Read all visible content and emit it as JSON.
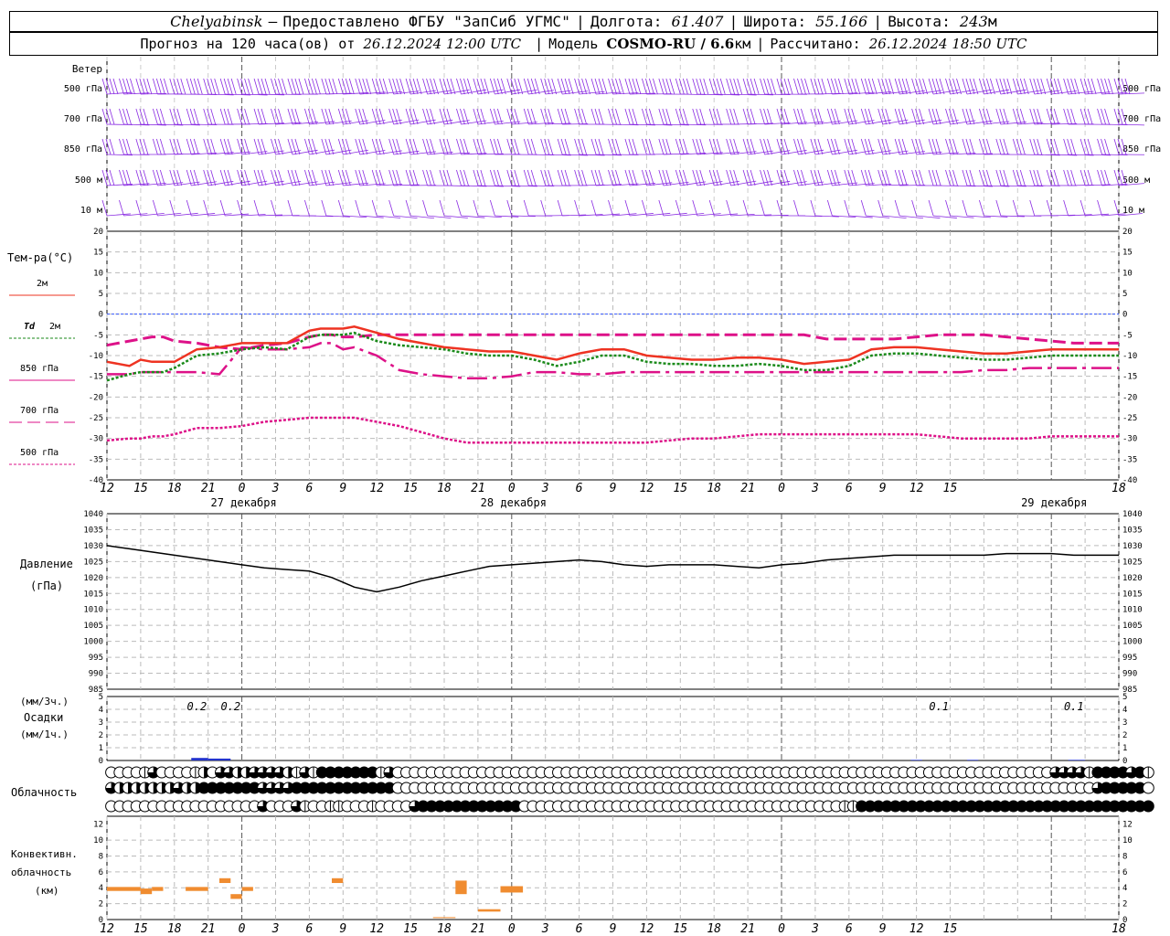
{
  "header": {
    "station": "Chelyabinsk",
    "dash": "–",
    "provider": "Предоставлено ФГБУ \"ЗапСиб УГМС\"",
    "lon_label": "Долгота:",
    "lon": "61.407",
    "lat_label": "Широта:",
    "lat": "55.166",
    "alt_label": "Высота:",
    "alt": "243",
    "alt_unit": "м",
    "forecast_label": "Прогноз на 120 часа(ов) от",
    "forecast_time": "26.12.2024 12:00 UTC",
    "model_label": "Модель",
    "model": "COSMO-RU / 6.6",
    "model_unit": "км",
    "calc_label": "Рассчитано:",
    "calc_time": "26.12.2024 18:50 UTC"
  },
  "x_ticks": [
    "12",
    "15",
    "18",
    "21",
    "0",
    "3",
    "6",
    "9",
    "12",
    "15",
    "18",
    "21",
    "0",
    "3",
    "6",
    "9",
    "12",
    "15",
    "18",
    "21",
    "0",
    "3",
    "6",
    "9",
    "12",
    "15",
    "18"
  ],
  "day_labels": [
    "27 декабря",
    "28 декабря",
    "29 декабря"
  ],
  "wind": {
    "title": "Ветер",
    "levels": [
      "500 гПа",
      "700 гПа",
      "850 гПа",
      "500 м",
      "10  м"
    ],
    "color": "#8a2be2"
  },
  "temperature": {
    "title": "Тем-ра(°С)",
    "ticks": [
      "20",
      "15",
      "10",
      "5",
      "0",
      "-5",
      "-10",
      "-15",
      "-20",
      "-25",
      "-30",
      "-35",
      "-40"
    ],
    "legend": [
      {
        "label": "2м",
        "color": "#ee3322"
      },
      {
        "label_a": "Td",
        "label": "2м",
        "color": "#1a8a1a"
      },
      {
        "label": "850 гПа",
        "color": "#dd1188"
      },
      {
        "label": "700 гПа",
        "color": "#dd1188"
      },
      {
        "label": "500 гПа",
        "color": "#dd1188"
      }
    ]
  },
  "pressure": {
    "title": "Давление",
    "unit": "(гПа)",
    "ticks": [
      "1040",
      "1035",
      "1030",
      "1025",
      "1020",
      "1015",
      "1010",
      "1005",
      "1000",
      "995",
      "990",
      "985"
    ]
  },
  "precipitation": {
    "unit_a": "(мм/3ч.)",
    "title": "Осадки",
    "unit_b": "(мм/1ч.)",
    "ticks": [
      "5",
      "4",
      "3",
      "2",
      "1",
      "0"
    ],
    "labels": [
      {
        "hour": 8,
        "text": "0.2"
      },
      {
        "hour": 11,
        "text": "0.2"
      },
      {
        "hour": 74,
        "text": "0.1"
      },
      {
        "hour": 86,
        "text": "0.1"
      }
    ],
    "color": "#2233cc"
  },
  "clouds": {
    "title": "Облачность",
    "rows": [
      "0000130000120332233332131444444413000000000000000000000000000000000000000000000000000000000000000000000000000000333314444341",
      "3222222232244444443333444444444444000000000000000000000000000000000000000000000000000000000000000000000000000000000003444440",
      "0000000000000000003000310011000100003444444444444000000000000000000000000000000000000001144444444444444444444444444444444444"
    ]
  },
  "convective": {
    "title_a": "Конвективн.",
    "title_b": "облачность",
    "unit": "(км)",
    "ticks": [
      "12",
      "10",
      "8",
      "6",
      "4",
      "2",
      "0"
    ],
    "color": "#f08c30",
    "bars": [
      {
        "h0": 0,
        "h1": 3,
        "lo": 3.6,
        "hi": 4.1
      },
      {
        "h0": 3,
        "h1": 4,
        "lo": 3.2,
        "hi": 3.9
      },
      {
        "h0": 4,
        "h1": 5,
        "lo": 3.6,
        "hi": 4.1
      },
      {
        "h0": 7,
        "h1": 9,
        "lo": 3.6,
        "hi": 4.1
      },
      {
        "h0": 10,
        "h1": 11,
        "lo": 4.6,
        "hi": 5.2
      },
      {
        "h0": 11,
        "h1": 12,
        "lo": 2.6,
        "hi": 3.2
      },
      {
        "h0": 12,
        "h1": 13,
        "lo": 3.6,
        "hi": 4.1
      },
      {
        "h0": 20,
        "h1": 21,
        "lo": 4.6,
        "hi": 5.2
      },
      {
        "h0": 29,
        "h1": 31,
        "lo": 0.2,
        "hi": 0.3
      },
      {
        "h0": 31,
        "h1": 32,
        "lo": 3.2,
        "hi": 4.9
      },
      {
        "h0": 33,
        "h1": 35,
        "lo": 1.0,
        "hi": 1.3
      },
      {
        "h0": 35,
        "h1": 37,
        "lo": 3.4,
        "hi": 4.2
      }
    ]
  },
  "chart_data": {
    "type": "line",
    "x_unit": "hours from 26.12.2024 12:00 UTC",
    "temperature_x": [
      0,
      2,
      3,
      4,
      5,
      6,
      8,
      10,
      12,
      14,
      16,
      18,
      19,
      20,
      21,
      22,
      24,
      26,
      28,
      30,
      32,
      34,
      36,
      38,
      40,
      42,
      44,
      46,
      48,
      50,
      52,
      54,
      56,
      58,
      60,
      62,
      64,
      66,
      68,
      70,
      72,
      74,
      76,
      78,
      80,
      82,
      84,
      86,
      88,
      90
    ],
    "series": [
      {
        "name": "2м",
        "values": [
          -11.5,
          -12.5,
          -11,
          -11.5,
          -11.5,
          -11.5,
          -8.5,
          -8,
          -7,
          -7,
          -7,
          -4,
          -3.5,
          -3.5,
          -3.5,
          -3,
          -4.5,
          -6,
          -7,
          -8,
          -8.5,
          -9,
          -9,
          -10,
          -11,
          -9.5,
          -8.5,
          -8.5,
          -10,
          -10.5,
          -11,
          -11,
          -10.5,
          -10.5,
          -11,
          -12,
          -11.5,
          -11,
          -8.5,
          -8,
          -8,
          -8.5,
          -9,
          -9.5,
          -9.5,
          -9,
          -8.5,
          -8.5,
          -8.5,
          -8.5
        ]
      },
      {
        "name": "Td 2м",
        "values": [
          -16,
          -14.5,
          -14,
          -14,
          -14,
          -13,
          -10,
          -9.5,
          -8.5,
          -8,
          -8.5,
          -5.5,
          -5,
          -5,
          -5,
          -4.5,
          -6.5,
          -7.5,
          -8,
          -8.5,
          -9.5,
          -10,
          -10,
          -11,
          -12.5,
          -11.5,
          -10,
          -10,
          -11.5,
          -12,
          -12,
          -12.5,
          -12.5,
          -12,
          -12.5,
          -13.5,
          -13.5,
          -12.5,
          -10,
          -9.5,
          -9.5,
          -10,
          -10.5,
          -11,
          -11,
          -10.5,
          -10,
          -10,
          -10,
          -10
        ]
      },
      {
        "name": "850 гПа",
        "values": [
          -14.5,
          -14.5,
          -14,
          -14,
          -14,
          -14,
          -14,
          -14.5,
          -8,
          -8.5,
          -8.5,
          -8,
          -7,
          -7,
          -8.5,
          -8,
          -10,
          -13.5,
          -14.5,
          -15,
          -15.5,
          -15.5,
          -15,
          -14,
          -14,
          -14.5,
          -14.5,
          -14,
          -14,
          -14,
          -14,
          -14,
          -14,
          -14,
          -14,
          -14,
          -14,
          -14,
          -14,
          -14,
          -14,
          -14,
          -14,
          -13.5,
          -13.5,
          -13,
          -13,
          -13,
          -13,
          -13
        ]
      },
      {
        "name": "700 гПа",
        "values": [
          -7.5,
          -6.5,
          -6,
          -5.5,
          -5.5,
          -6.5,
          -7,
          -8,
          -8.5,
          -7.5,
          -7,
          -5.5,
          -5,
          -5,
          -5.5,
          -5.5,
          -5,
          -5,
          -5,
          -5,
          -5,
          -5,
          -5,
          -5,
          -5,
          -5,
          -5,
          -5,
          -5,
          -5,
          -5,
          -5,
          -5,
          -5,
          -5,
          -5,
          -6,
          -6,
          -6,
          -6,
          -5.5,
          -5,
          -5,
          -5,
          -5.5,
          -6,
          -6.5,
          -7,
          -7,
          -7
        ]
      },
      {
        "name": "500 гПа",
        "values": [
          -30.5,
          -30,
          -30,
          -29.5,
          -29.5,
          -29,
          -27.5,
          -27.5,
          -27,
          -26,
          -25.5,
          -25,
          -25,
          -25,
          -25,
          -25,
          -26,
          -27,
          -28.5,
          -30,
          -31,
          -31,
          -31,
          -31,
          -31,
          -31,
          -31,
          -31,
          -31,
          -30.5,
          -30,
          -30,
          -29.5,
          -29,
          -29,
          -29,
          -29,
          -29,
          -29,
          -29,
          -29,
          -29.5,
          -30,
          -30,
          -30,
          -30,
          -29.5,
          -29.5,
          -29.5,
          -29.5
        ]
      }
    ],
    "pressure_x": [
      0,
      2,
      4,
      6,
      8,
      10,
      12,
      14,
      16,
      18,
      20,
      22,
      24,
      26,
      28,
      30,
      32,
      34,
      36,
      38,
      40,
      42,
      44,
      46,
      48,
      50,
      52,
      54,
      56,
      58,
      60,
      62,
      64,
      66,
      68,
      70,
      72,
      74,
      76,
      78,
      80,
      82,
      84,
      86,
      88,
      90
    ],
    "pressure": [
      1030,
      1029,
      1028,
      1027,
      1026,
      1025,
      1024,
      1023,
      1022.5,
      1022,
      1020,
      1017,
      1015.5,
      1017,
      1019,
      1020.5,
      1022,
      1023.5,
      1024,
      1024.5,
      1025,
      1025.5,
      1025,
      1024,
      1023.5,
      1024,
      1024,
      1024,
      1023.5,
      1023,
      1024,
      1024.5,
      1025.5,
      1026,
      1026.5,
      1027,
      1027,
      1027,
      1027,
      1027,
      1027.5,
      1027.5,
      1027.5,
      1027,
      1027,
      1027
    ],
    "ylim_temperature": [
      -40,
      20
    ],
    "ylim_pressure": [
      985,
      1040
    ],
    "ylim_precipitation": [
      0,
      5
    ],
    "ylim_convective": [
      0,
      13
    ]
  }
}
